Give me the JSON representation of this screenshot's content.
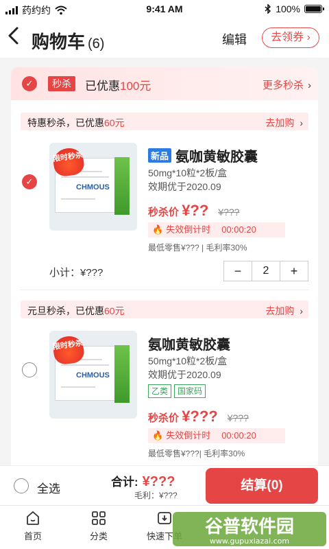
{
  "status_bar": {
    "carrier": "药约约",
    "time": "9:41 AM",
    "battery": "100%",
    "battery_level": 1.0
  },
  "header": {
    "back_icon": "chevron-left-icon",
    "title": "购物车",
    "count": "(6)",
    "edit": "编辑",
    "coupon": "去领券"
  },
  "flash_sale": {
    "tag": "秒杀",
    "saved_prefix": "已优惠",
    "saved_amount": "100元",
    "more": "更多秒杀",
    "selected": true
  },
  "groups": [
    {
      "promo_prefix": "特惠秒杀，已优惠",
      "promo_amount": "60元",
      "promo_action": "去加购",
      "item": {
        "badge": "限时秒杀",
        "new_tag": "新品",
        "name": "氨咖黄敏胶囊",
        "spec": "50mg*10粒*2板/盒",
        "expiry": "效期优于2020.09",
        "price_label": "秒杀价",
        "price": "¥??",
        "original_price": "¥???",
        "countdown_label": "失效倒计时",
        "countdown": "00:00:20",
        "meta": "最低零售¥??? | 毛利率30%",
        "subtotal": "小计：¥???",
        "quantity": "2",
        "selected": true,
        "brand": "CHMOUS"
      }
    },
    {
      "promo_prefix": "元旦秒杀，已优惠",
      "promo_amount": "60元",
      "promo_action": "去加购",
      "item": {
        "badge": "限时秒杀",
        "name": "氨咖黄敏胶囊",
        "spec": "50mg*10粒*2板/盒",
        "expiry": "效期优于2020.09",
        "tags": [
          "乙类",
          "国家码"
        ],
        "price_label": "秒杀价",
        "price": "¥???",
        "original_price": "¥???",
        "countdown_label": "失效倒计时",
        "countdown": "00:00:20",
        "meta": "最低零售¥???| 毛利率30%",
        "selected": false,
        "brand": "CHMOUS"
      }
    }
  ],
  "footer": {
    "select_all": "全选",
    "total_label": "合计:",
    "total": "¥???",
    "gross": "毛利：¥???",
    "checkout": "结算(0)"
  },
  "tabbar": [
    {
      "label": "首页",
      "icon": "home-icon"
    },
    {
      "label": "分类",
      "icon": "category-icon"
    },
    {
      "label": "快速下单",
      "icon": "quick-order-icon"
    }
  ],
  "watermark": {
    "text": "谷普软件园",
    "url": "www.gupuxiazai.com"
  },
  "colors": {
    "accent": "#e64545",
    "tag_blue": "#2c7be5",
    "tag_green": "#3aa55c"
  }
}
